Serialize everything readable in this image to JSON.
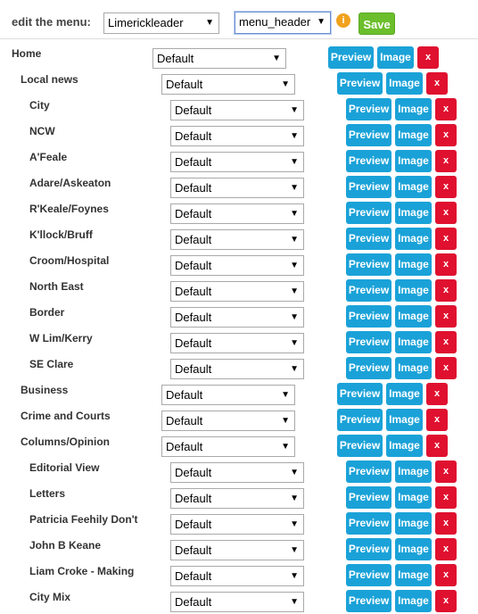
{
  "header": {
    "label": "edit the menu:",
    "site_select": "Limerickleader",
    "menu_select": "menu_header",
    "info_icon": "i",
    "save_label": "Save"
  },
  "row_buttons": {
    "preview_label": "Preview",
    "image_label": "Image",
    "delete_label": "x"
  },
  "menu_items": [
    {
      "label": "Home",
      "level": 0,
      "template": "Default"
    },
    {
      "label": "Local news",
      "level": 1,
      "template": "Default"
    },
    {
      "label": "City",
      "level": 2,
      "template": "Default"
    },
    {
      "label": "NCW",
      "level": 2,
      "template": "Default"
    },
    {
      "label": "A'Feale",
      "level": 2,
      "template": "Default"
    },
    {
      "label": "Adare/Askeaton",
      "level": 2,
      "template": "Default"
    },
    {
      "label": "R'Keale/Foynes",
      "level": 2,
      "template": "Default"
    },
    {
      "label": "K'llock/Bruff",
      "level": 2,
      "template": "Default"
    },
    {
      "label": "Croom/Hospital",
      "level": 2,
      "template": "Default"
    },
    {
      "label": "North East",
      "level": 2,
      "template": "Default"
    },
    {
      "label": "Border",
      "level": 2,
      "template": "Default"
    },
    {
      "label": "W Lim/Kerry",
      "level": 2,
      "template": "Default"
    },
    {
      "label": "SE Clare",
      "level": 2,
      "template": "Default"
    },
    {
      "label": "Business",
      "level": 1,
      "template": "Default"
    },
    {
      "label": "Crime and Courts",
      "level": 1,
      "template": "Default"
    },
    {
      "label": "Columns/Opinion",
      "level": 1,
      "template": "Default"
    },
    {
      "label": "Editorial View",
      "level": 2,
      "template": "Default"
    },
    {
      "label": "Letters",
      "level": 2,
      "template": "Default"
    },
    {
      "label": "Patricia Feehily Don't",
      "level": 2,
      "template": "Default"
    },
    {
      "label": "John B Keane",
      "level": 2,
      "template": "Default"
    },
    {
      "label": "Liam Croke - Making",
      "level": 2,
      "template": "Default"
    },
    {
      "label": "City Mix",
      "level": 2,
      "template": "Default"
    }
  ],
  "colors": {
    "button_blue": "#1aa2d8",
    "delete_red": "#e0102f",
    "save_green": "#6cbf2c",
    "info_orange": "#f0a21f"
  }
}
